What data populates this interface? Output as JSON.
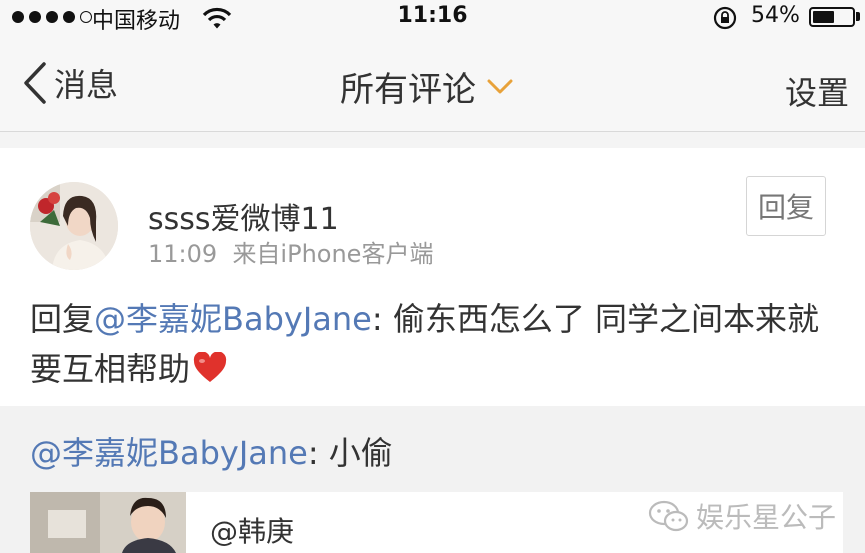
{
  "status_bar": {
    "carrier": "中国移动",
    "time": "11:16",
    "battery_percent": "54%",
    "battery_level": 0.54,
    "signal_bars_filled": 4,
    "signal_bars_total": 5
  },
  "nav": {
    "back_label": "消息",
    "title": "所有评论",
    "settings_label": "设置",
    "accent_color": "#e8a23a"
  },
  "comment": {
    "username": "ssss爱微博11",
    "time": "11:09",
    "source": "来自iPhone客户端",
    "reply_button": "回复",
    "prefix": "回复",
    "mention": "@李嘉妮BabyJane",
    "text": ": 偷东西怎么了 同学之间本来就要互相帮助",
    "emoji": "heart-emoji"
  },
  "original": {
    "mention": "@李嘉妮BabyJane",
    "text": ": 小偷",
    "embed_author": "@韩庚"
  },
  "watermark": {
    "text": "娱乐星公子"
  },
  "colors": {
    "link": "#5479b5",
    "meta": "#999999",
    "heart": "#e0322c"
  }
}
